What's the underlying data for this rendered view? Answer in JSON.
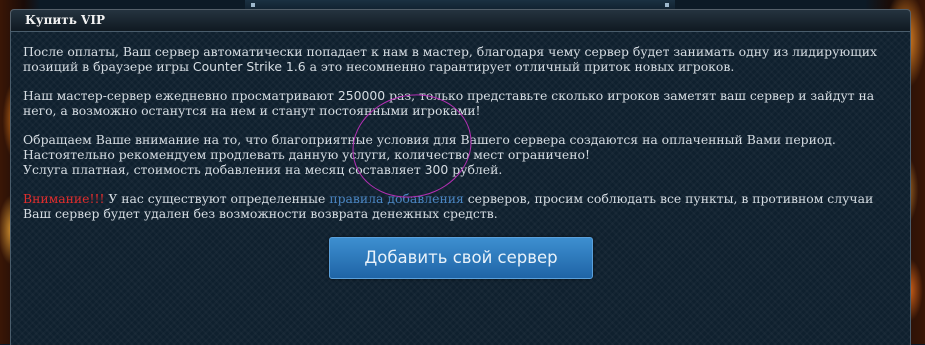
{
  "title": "Купить VIP",
  "paragraph1": {
    "text_before": "После оплаты, Ваш сервер автоматически попадает к нам в мастер, благодаря чему сервер будет занимать одну из лидирующих позиций в браузере игры ",
    "game": "Counter Strike 1.6",
    "text_after": " а это несомненно гарантирует отличный приток новых игроков."
  },
  "paragraph2": {
    "text_before": "Наш мастер-сервер ежедневно просматривают ",
    "count": "250000",
    "text_after": " раз, только представьте сколько игроков заметят ваш сервер и зайдут на него, а возможно останутся на нем и станут постоянными игроками!"
  },
  "paragraph3": {
    "line1": "Обращаем Ваше внимание на то, что благоприятные условия для Вашего сервера создаются на оплаченный Вами период. Настоятельно рекомендуем продлевать данную услуги, количество мест ограничено!",
    "line2_before": "Услуга платная, стоимость добавления на месяц составляет ",
    "price": "300",
    "line2_after": " рублей."
  },
  "paragraph4": {
    "warning": "Внимание!!!",
    "text_before": " У нас существуют определенные ",
    "link": "правила добавления",
    "text_after": " серверов, просим соблюдать все пункты, в противном случаи Ваш сервер будет удален без возможности возврата денежных средств."
  },
  "button_label": "Добавить свой сервер",
  "colors": {
    "warning": "#e02d2d",
    "link": "#4b87c4",
    "button": "#2a78bd",
    "annotation_circle": "#b42fb4"
  }
}
